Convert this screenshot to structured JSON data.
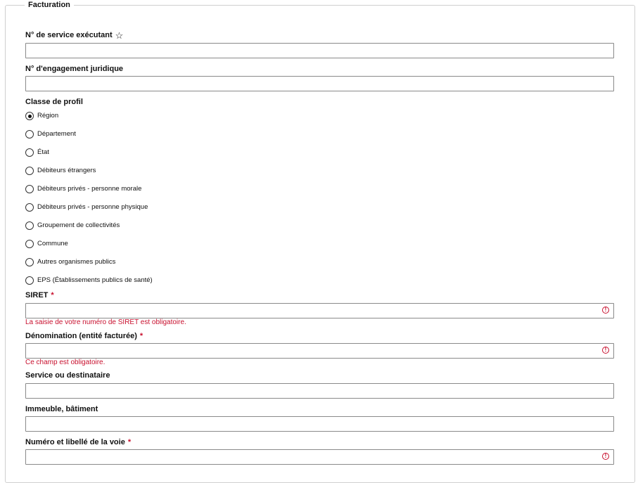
{
  "section": {
    "legend": "Facturation"
  },
  "fields": {
    "service_executant": {
      "label": "N° de service exécutant",
      "value": ""
    },
    "engagement_juridique": {
      "label": "N° d'engagement juridique",
      "value": ""
    },
    "siret": {
      "label": "SIRET",
      "required_mark": "*",
      "value": "",
      "error": "La saisie de votre numéro de SIRET est obligatoire."
    },
    "denomination": {
      "label": "Dénomination (entité facturée)",
      "required_mark": "*",
      "value": "",
      "error": "Ce champ est obligatoire."
    },
    "service_destinataire": {
      "label": "Service ou destinataire",
      "value": ""
    },
    "immeuble": {
      "label": "Immeuble, bâtiment",
      "value": ""
    },
    "voie": {
      "label": "Numéro et libellé de la voie",
      "required_mark": "*",
      "value": ""
    }
  },
  "profile_class": {
    "label": "Classe de profil",
    "selected": "Région",
    "options": [
      "Région",
      "Département",
      "État",
      "Débiteurs étrangers",
      "Débiteurs privés - personne morale",
      "Débiteurs privés - personne physique",
      "Groupement de collectivités",
      "Commune",
      "Autres organismes publics",
      "EPS (Établissements publics de santé)"
    ]
  },
  "icons": {
    "favorite": "star-outline-icon",
    "error": "alert-circle-icon"
  },
  "colors": {
    "error": "#c8102e",
    "border": "#8a8a8a"
  }
}
